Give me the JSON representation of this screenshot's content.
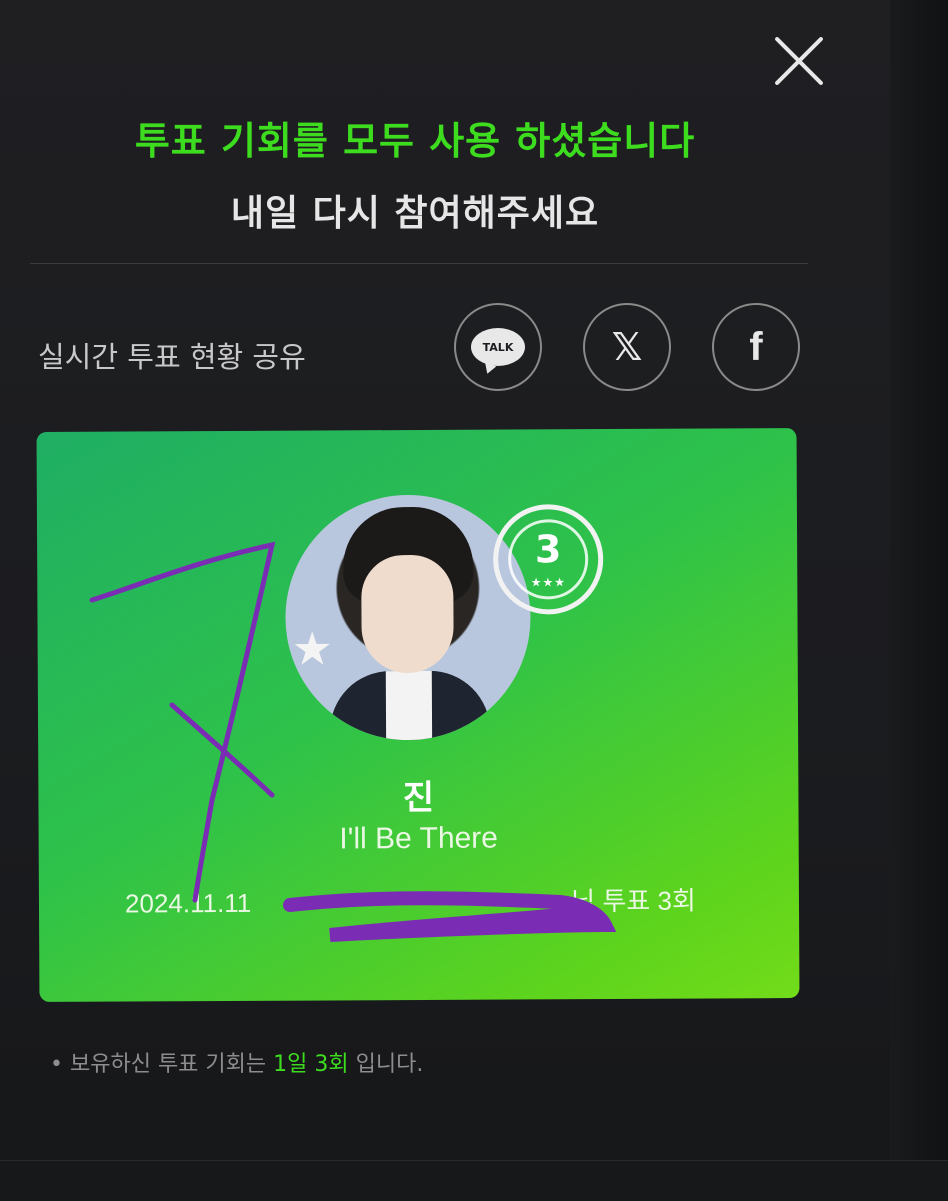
{
  "modal": {
    "title_line1": "투표 기회를 모두 사용 하셨습니다",
    "title_line2": "내일 다시 참여해주세요",
    "close_icon": "close-icon"
  },
  "share": {
    "label": "실시간 투표 현황 공유",
    "kakao_text": "TALK",
    "x_glyph": "𝕏",
    "facebook_glyph": "f"
  },
  "card": {
    "badge_number": "3",
    "badge_stars": "★★★",
    "artist": "진",
    "song": "I'll Be There",
    "date": "2024.11.11",
    "vote_suffix": "님 투표 3회"
  },
  "footer": {
    "bullet": "•",
    "note_prefix": "보유하신 투표 기회는",
    "note_highlight": "1일 3회",
    "note_suffix": "입니다."
  },
  "colors": {
    "accent_green": "#3ddc1f",
    "card_green": "#2ec24a",
    "scribble_purple": "#7b2cb5"
  }
}
